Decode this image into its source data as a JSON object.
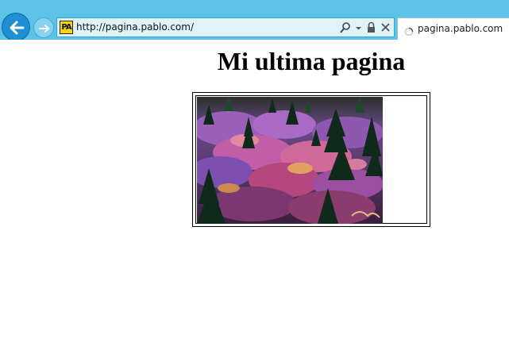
{
  "browser": {
    "address": {
      "url": "http://pagina.pablo.com/",
      "favicon_text": "PA"
    },
    "tab": {
      "label": "pagina.pablo.com"
    },
    "icons": {
      "back": "back-arrow-icon",
      "forward": "forward-arrow-icon",
      "search": "search-icon",
      "dropdown": "dropdown-icon",
      "lock": "lock-icon",
      "stop": "stop-icon",
      "loading": "loading-spinner-icon"
    },
    "colors": {
      "toolbar": "#5bc3e8",
      "back_button": "#1e8fd2"
    }
  },
  "page": {
    "heading": "Mi ultima pagina",
    "image": {
      "description_icon": "forest-photo"
    }
  }
}
